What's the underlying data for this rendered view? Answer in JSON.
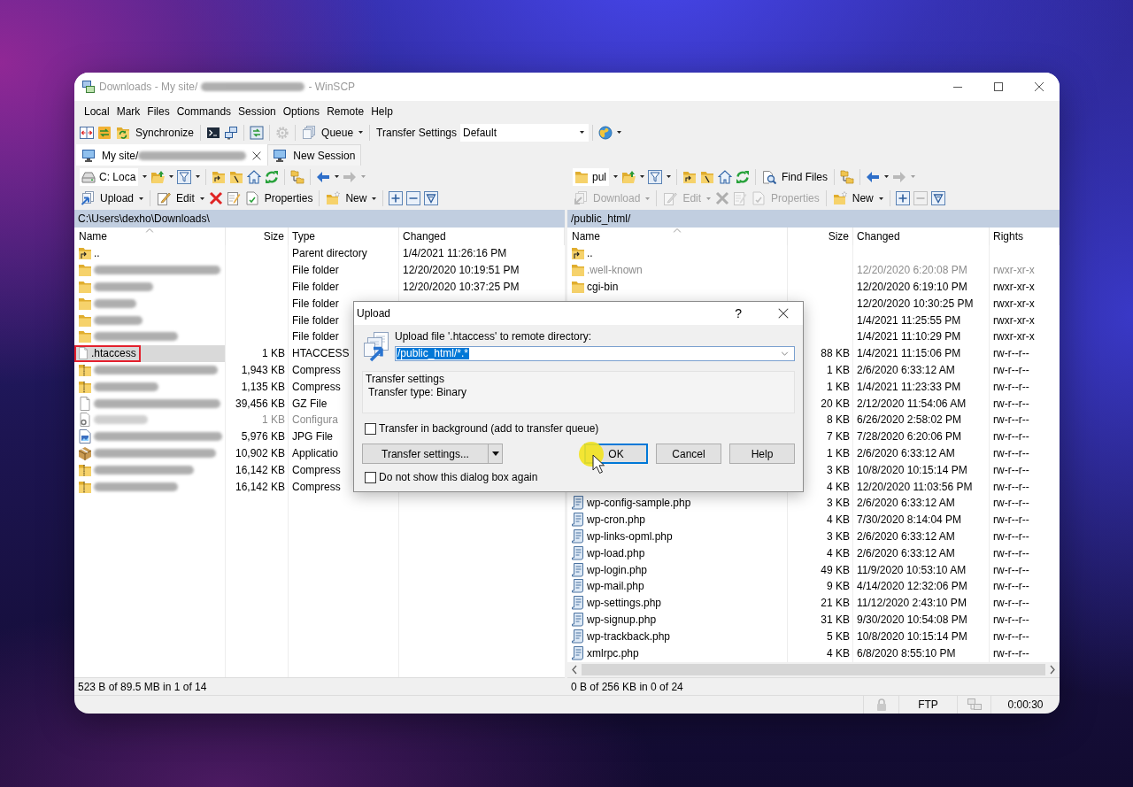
{
  "window": {
    "title": "Downloads - My site/",
    "title_redacted": true,
    "title_suffix": "- WinSCP"
  },
  "menu": [
    "Local",
    "Mark",
    "Files",
    "Commands",
    "Session",
    "Options",
    "Remote",
    "Help"
  ],
  "toolbar": [
    {
      "kind": "tool",
      "disabled": false,
      "dropdown": false
    },
    {
      "kind": "tool",
      "disabled": false,
      "dropdown": false
    },
    {
      "kind": "button",
      "label": "Synchronize",
      "disabled": false,
      "dropdown": false
    },
    {
      "kind": "separator"
    },
    {
      "kind": "tool",
      "disabled": false,
      "dropdown": false
    },
    {
      "kind": "tool",
      "disabled": false,
      "dropdown": false
    },
    {
      "kind": "separator"
    },
    {
      "kind": "tool",
      "disabled": false,
      "dropdown": false
    },
    {
      "kind": "separator"
    },
    {
      "kind": "tool",
      "disabled": true,
      "dropdown": false
    },
    {
      "kind": "separator"
    },
    {
      "kind": "button",
      "label": "Queue",
      "disabled": false,
      "dropdown": true
    },
    {
      "kind": "separator"
    },
    {
      "kind": "label",
      "label": "Transfer Settings"
    },
    {
      "kind": "combo",
      "value": "Default",
      "dropdown": true
    },
    {
      "kind": "separator"
    },
    {
      "kind": "tool",
      "disabled": false,
      "dropdown": true
    }
  ],
  "session_tabs": [
    {
      "label": "My site/",
      "redacted": true,
      "selected": true,
      "closable": true
    },
    {
      "label": "New Session",
      "redacted": false,
      "selected": false,
      "closable": false
    }
  ],
  "local_panel": {
    "nav_toolbar": [
      {
        "kind": "location",
        "value": "C: Loca",
        "dropdown": true
      },
      {
        "kind": "tool",
        "disabled": false,
        "dropdown": true
      },
      {
        "kind": "tool",
        "disabled": false,
        "dropdown": true
      },
      {
        "kind": "separator"
      },
      {
        "kind": "tool",
        "disabled": false,
        "dropdown": false
      },
      {
        "kind": "tool",
        "disabled": false,
        "dropdown": false
      },
      {
        "kind": "tool",
        "disabled": false,
        "dropdown": false
      },
      {
        "kind": "tool",
        "disabled": false,
        "dropdown": false
      },
      {
        "kind": "separator"
      },
      {
        "kind": "tool",
        "disabled": false,
        "dropdown": false
      },
      {
        "kind": "separator"
      },
      {
        "kind": "tool",
        "disabled": false,
        "dropdown": true
      },
      {
        "kind": "tool",
        "disabled": true,
        "dropdown": true
      }
    ],
    "file_toolbar": [
      {
        "kind": "button",
        "label": "Upload",
        "disabled": false,
        "dropdown": true
      },
      {
        "kind": "separator"
      },
      {
        "kind": "button",
        "label": "Edit",
        "disabled": false,
        "dropdown": true
      },
      {
        "kind": "tool",
        "disabled": false,
        "dropdown": false
      },
      {
        "kind": "tool",
        "disabled": false,
        "dropdown": false
      },
      {
        "kind": "button",
        "label": "Properties",
        "disabled": false,
        "dropdown": false
      },
      {
        "kind": "separator"
      },
      {
        "kind": "button",
        "label": "New",
        "disabled": false,
        "dropdown": true
      },
      {
        "kind": "separator"
      },
      {
        "kind": "tool",
        "disabled": false,
        "dropdown": false
      },
      {
        "kind": "tool",
        "disabled": false,
        "dropdown": false
      },
      {
        "kind": "tool",
        "disabled": false,
        "dropdown": false
      }
    ],
    "path": "C:\\Users\\dexho\\Downloads\\",
    "columns": [
      {
        "label": "Name",
        "kind": "name",
        "sorted": true
      },
      {
        "label": "Size",
        "kind": "size",
        "sorted": false
      },
      {
        "label": "Type",
        "kind": "type",
        "sorted": false
      },
      {
        "label": "Changed",
        "kind": "changed",
        "sorted": false
      }
    ],
    "rows": [
      {
        "kind": "parent",
        "name": "..",
        "redacted": false,
        "selected": false,
        "marked": false,
        "hidden": false,
        "type": "Parent directory",
        "changed": "1/4/2021 11:26:16 PM"
      },
      {
        "kind": "folder",
        "redacted": true,
        "selected": false,
        "marked": false,
        "hidden": false,
        "type": "File folder",
        "changed": "12/20/2020 10:19:51 PM"
      },
      {
        "kind": "folder",
        "redacted": true,
        "selected": false,
        "marked": false,
        "hidden": false,
        "type": "File folder",
        "changed": "12/20/2020 10:37:25 PM"
      },
      {
        "kind": "folder",
        "redacted": true,
        "selected": false,
        "marked": false,
        "hidden": false,
        "type": "File folder"
      },
      {
        "kind": "folder",
        "redacted": true,
        "selected": false,
        "marked": false,
        "hidden": false,
        "type": "File folder"
      },
      {
        "kind": "folder",
        "redacted": true,
        "selected": false,
        "marked": false,
        "hidden": false,
        "type": "File folder"
      },
      {
        "kind": "file",
        "name": ".htaccess",
        "redacted": false,
        "selected": true,
        "marked": true,
        "hidden": false,
        "size": "1 KB",
        "type": "HTACCESS"
      },
      {
        "kind": "zip",
        "redacted": true,
        "selected": false,
        "marked": false,
        "hidden": false,
        "size": "1,943 KB",
        "type": "Compress"
      },
      {
        "kind": "zip",
        "redacted": true,
        "selected": false,
        "marked": false,
        "hidden": false,
        "size": "1,135 KB",
        "type": "Compress"
      },
      {
        "kind": "file",
        "redacted": true,
        "selected": false,
        "marked": false,
        "hidden": false,
        "size": "39,456 KB",
        "type": "GZ File"
      },
      {
        "kind": "config",
        "redacted": true,
        "selected": false,
        "marked": false,
        "hidden": true,
        "size": "1 KB",
        "type": "Configura"
      },
      {
        "kind": "image",
        "redacted": true,
        "selected": false,
        "marked": false,
        "hidden": false,
        "size": "5,976 KB",
        "type": "JPG File"
      },
      {
        "kind": "installer",
        "redacted": true,
        "selected": false,
        "marked": false,
        "hidden": false,
        "size": "10,902 KB",
        "type": "Applicatio"
      },
      {
        "kind": "zip",
        "redacted": true,
        "selected": false,
        "marked": false,
        "hidden": false,
        "size": "16,142 KB",
        "type": "Compress"
      },
      {
        "kind": "zip",
        "redacted": true,
        "selected": false,
        "marked": false,
        "hidden": false,
        "size": "16,142 KB",
        "type": "Compress"
      }
    ],
    "status": "523 B of 89.5 MB in 1 of 14"
  },
  "remote_panel": {
    "nav_toolbar": [
      {
        "kind": "location",
        "value": "pul",
        "dropdown": true
      },
      {
        "kind": "tool",
        "disabled": false,
        "dropdown": true
      },
      {
        "kind": "tool",
        "disabled": false,
        "dropdown": true
      },
      {
        "kind": "separator"
      },
      {
        "kind": "tool",
        "disabled": false,
        "dropdown": false
      },
      {
        "kind": "tool",
        "disabled": false,
        "dropdown": false
      },
      {
        "kind": "tool",
        "disabled": false,
        "dropdown": false
      },
      {
        "kind": "tool",
        "disabled": false,
        "dropdown": false
      },
      {
        "kind": "separator"
      },
      {
        "kind": "button",
        "label": "Find Files",
        "disabled": false,
        "dropdown": false
      },
      {
        "kind": "separator"
      },
      {
        "kind": "tool",
        "disabled": false,
        "dropdown": false
      },
      {
        "kind": "separator"
      },
      {
        "kind": "tool",
        "disabled": false,
        "dropdown": true
      },
      {
        "kind": "tool",
        "disabled": true,
        "dropdown": true
      }
    ],
    "file_toolbar": [
      {
        "kind": "button",
        "label": "Download",
        "disabled": true,
        "dropdown": true
      },
      {
        "kind": "separator"
      },
      {
        "kind": "button",
        "label": "Edit",
        "disabled": true,
        "dropdown": true
      },
      {
        "kind": "tool",
        "disabled": true,
        "dropdown": false
      },
      {
        "kind": "tool",
        "disabled": true,
        "dropdown": false
      },
      {
        "kind": "button",
        "label": "Properties",
        "disabled": true,
        "dropdown": false
      },
      {
        "kind": "separator"
      },
      {
        "kind": "button",
        "label": "New",
        "disabled": false,
        "dropdown": true
      },
      {
        "kind": "separator"
      },
      {
        "kind": "tool",
        "disabled": false,
        "dropdown": false
      },
      {
        "kind": "tool",
        "disabled": true,
        "dropdown": false
      },
      {
        "kind": "tool",
        "disabled": false,
        "dropdown": false
      }
    ],
    "path": "/public_html/",
    "columns": [
      {
        "label": "Name",
        "kind": "name",
        "sorted": true
      },
      {
        "label": "Size",
        "kind": "size",
        "sorted": false
      },
      {
        "label": "Changed",
        "kind": "changed",
        "sorted": false
      },
      {
        "label": "Rights",
        "kind": "rights",
        "sorted": false
      }
    ],
    "rows": [
      {
        "kind": "parent",
        "name": "..",
        "selected": false,
        "hidden": false
      },
      {
        "kind": "folder",
        "name": ".well-known",
        "selected": false,
        "hidden": true,
        "changed": "12/20/2020 6:20:08 PM",
        "rights": "rwxr-xr-x"
      },
      {
        "kind": "folder",
        "name": "cgi-bin",
        "selected": false,
        "hidden": false,
        "changed": "12/20/2020 6:19:10 PM",
        "rights": "rwxr-xr-x"
      },
      {
        "hidden": false,
        "changed": "12/20/2020 10:30:25 PM",
        "rights": "rwxr-xr-x"
      },
      {
        "hidden": false,
        "changed": "1/4/2021 11:25:55 PM",
        "rights": "rwxr-xr-x"
      },
      {
        "hidden": false,
        "changed": "1/4/2021 11:10:29 PM",
        "rights": "rwxr-xr-x"
      },
      {
        "hidden": false,
        "size": "88 KB",
        "changed": "1/4/2021 11:15:06 PM",
        "rights": "rw-r--r--"
      },
      {
        "hidden": false,
        "size": "1 KB",
        "changed": "2/6/2020 6:33:12 AM",
        "rights": "rw-r--r--"
      },
      {
        "hidden": false,
        "size": "1 KB",
        "changed": "1/4/2021 11:23:33 PM",
        "rights": "rw-r--r--"
      },
      {
        "hidden": false,
        "size": "20 KB",
        "changed": "2/12/2020 11:54:06 AM",
        "rights": "rw-r--r--"
      },
      {
        "hidden": false,
        "size": "8 KB",
        "changed": "6/26/2020 2:58:02 PM",
        "rights": "rw-r--r--"
      },
      {
        "hidden": false,
        "size": "7 KB",
        "changed": "7/28/2020 6:20:06 PM",
        "rights": "rw-r--r--"
      },
      {
        "hidden": false,
        "size": "1 KB",
        "changed": "2/6/2020 6:33:12 AM",
        "rights": "rw-r--r--"
      },
      {
        "hidden": false,
        "size": "3 KB",
        "changed": "10/8/2020 10:15:14 PM",
        "rights": "rw-r--r--"
      },
      {
        "hidden": false,
        "size": "4 KB",
        "changed": "12/20/2020 11:03:56 PM",
        "rights": "rw-r--r--"
      },
      {
        "kind": "script",
        "name": "wp-config-sample.php",
        "selected": false,
        "hidden": false,
        "size": "3 KB",
        "changed": "2/6/2020 6:33:12 AM",
        "rights": "rw-r--r--"
      },
      {
        "kind": "script",
        "name": "wp-cron.php",
        "selected": false,
        "hidden": false,
        "size": "4 KB",
        "changed": "7/30/2020 8:14:04 PM",
        "rights": "rw-r--r--"
      },
      {
        "kind": "script",
        "name": "wp-links-opml.php",
        "selected": false,
        "hidden": false,
        "size": "3 KB",
        "changed": "2/6/2020 6:33:12 AM",
        "rights": "rw-r--r--"
      },
      {
        "kind": "script",
        "name": "wp-load.php",
        "selected": false,
        "hidden": false,
        "size": "4 KB",
        "changed": "2/6/2020 6:33:12 AM",
        "rights": "rw-r--r--"
      },
      {
        "kind": "script",
        "name": "wp-login.php",
        "selected": false,
        "hidden": false,
        "size": "49 KB",
        "changed": "11/9/2020 10:53:10 AM",
        "rights": "rw-r--r--"
      },
      {
        "kind": "script",
        "name": "wp-mail.php",
        "selected": false,
        "hidden": false,
        "size": "9 KB",
        "changed": "4/14/2020 12:32:06 PM",
        "rights": "rw-r--r--"
      },
      {
        "kind": "script",
        "name": "wp-settings.php",
        "selected": false,
        "hidden": false,
        "size": "21 KB",
        "changed": "11/12/2020 2:43:10 PM",
        "rights": "rw-r--r--"
      },
      {
        "kind": "script",
        "name": "wp-signup.php",
        "selected": false,
        "hidden": false,
        "size": "31 KB",
        "changed": "9/30/2020 10:54:08 PM",
        "rights": "rw-r--r--"
      },
      {
        "kind": "script",
        "name": "wp-trackback.php",
        "selected": false,
        "hidden": false,
        "size": "5 KB",
        "changed": "10/8/2020 10:15:14 PM",
        "rights": "rw-r--r--"
      },
      {
        "kind": "script",
        "name": "xmlrpc.php",
        "selected": false,
        "hidden": false,
        "size": "4 KB",
        "changed": "6/8/2020 8:55:10 PM",
        "rights": "rw-r--r--"
      }
    ],
    "status": "0 B of 256 KB in 0 of 24"
  },
  "dialog": {
    "title": "Upload",
    "help_button": "?",
    "prompt": "Upload file '.htaccess' to remote directory:",
    "target": {
      "value": "/public_html/*.*",
      "text_selected": true
    },
    "transfer_settings": {
      "title": "Transfer settings",
      "lines": [
        "Transfer type: Binary"
      ]
    },
    "background_checkbox": {
      "label": "Transfer in background (add to transfer queue)",
      "checked": false
    },
    "settings_button": "Transfer settings...",
    "buttons": [
      {
        "label": "OK",
        "focused": true
      },
      {
        "label": "Cancel",
        "focused": false
      },
      {
        "label": "Help",
        "focused": false
      }
    ],
    "dont_show_checkbox": {
      "label": "Do not show this dialog box again",
      "checked": false
    }
  },
  "status_bar": {
    "protocol": "FTP",
    "elapsed": "0:00:30"
  }
}
